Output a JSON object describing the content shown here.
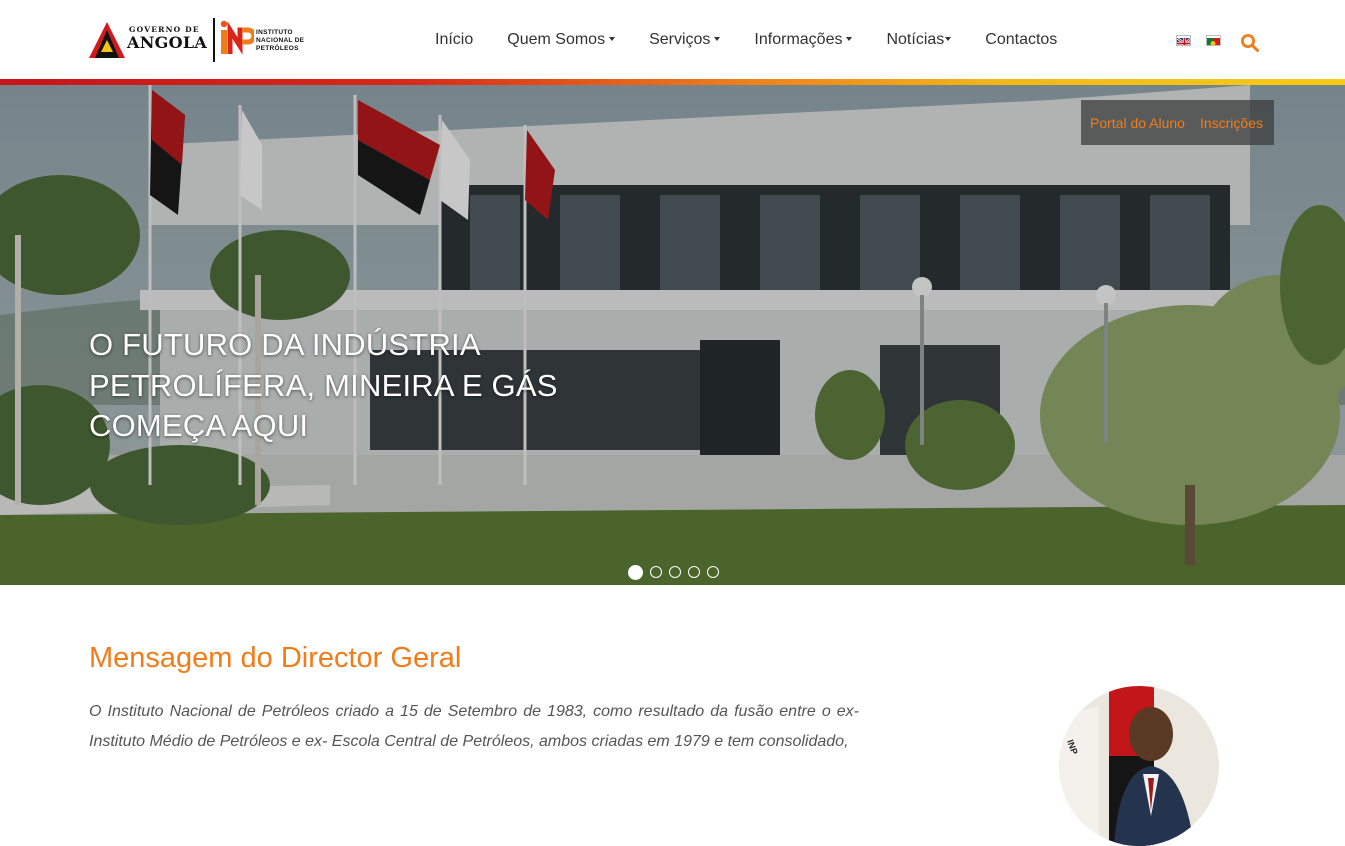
{
  "header": {
    "logo_gov_top": "GOVERNO DE",
    "logo_gov_main": "ANGOLA",
    "logo_inp_lines": [
      "INSTITUTO",
      "NACIONAL DE",
      "PETRÓLEOS"
    ],
    "nav": [
      {
        "label": "Início",
        "dropdown": false
      },
      {
        "label": "Quem Somos",
        "dropdown": true
      },
      {
        "label": "Serviços",
        "dropdown": true
      },
      {
        "label": "Informações",
        "dropdown": true
      },
      {
        "label": "Notícias",
        "dropdown": true
      },
      {
        "label": "Contactos",
        "dropdown": false
      }
    ],
    "languages": [
      "en-flag-icon",
      "pt-flag-icon"
    ],
    "search_icon": "search-icon"
  },
  "hero": {
    "portal_links": [
      "Portal do Aluno",
      "Inscrições"
    ],
    "headline_lines": [
      "O FUTURO DA INDÚSTRIA",
      "PETROLÍFERA, MINEIRA E GÁS",
      "COMEÇA AQUI"
    ],
    "slides_total": 5,
    "active_slide": 1
  },
  "message": {
    "title": "Mensagem do Director Geral",
    "body": "O Instituto Nacional de Petróleos criado a 15 de Setembro de 1983, como resultado da fusão entre o ex-Instituto Médio de Petróleos e ex- Escola Central de Petróleos, ambos criadas em 1979 e tem consolidado,"
  },
  "colors": {
    "accent": "#f07c1a",
    "stripe_red": "#c8141b",
    "stripe_yellow": "#f6cc14"
  }
}
